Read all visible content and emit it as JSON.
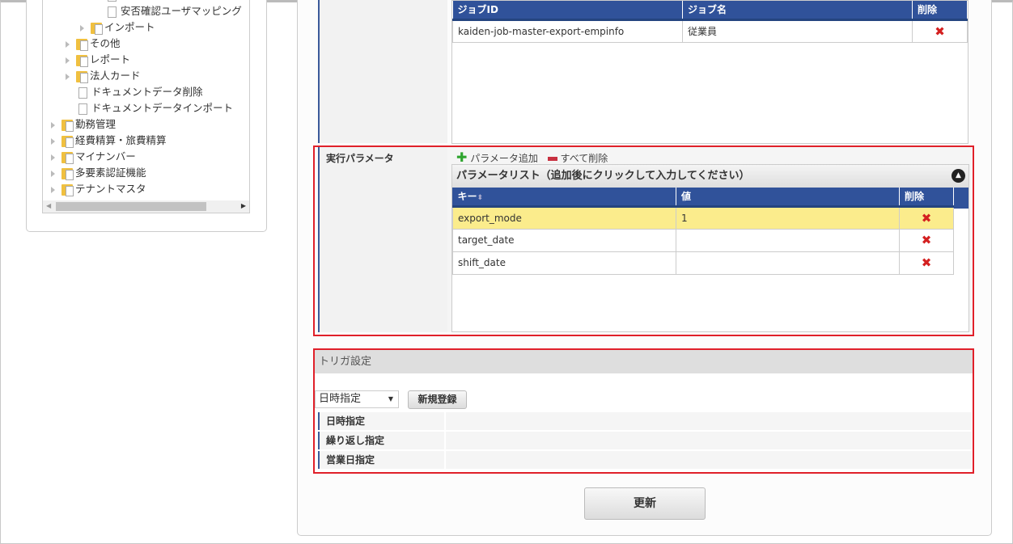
{
  "tree": {
    "items": [
      {
        "label": "安否確認ユーザマッピング",
        "type": "doc"
      },
      {
        "label": "インポート",
        "type": "folder"
      },
      {
        "label": "その他",
        "type": "folder"
      },
      {
        "label": "レポート",
        "type": "folder"
      },
      {
        "label": "法人カード",
        "type": "folder"
      },
      {
        "label": "ドキュメントデータ削除",
        "type": "doc"
      },
      {
        "label": "ドキュメントデータインポート",
        "type": "doc"
      },
      {
        "label": "勤務管理",
        "type": "folder"
      },
      {
        "label": "経費精算・旅費精算",
        "type": "folder"
      },
      {
        "label": "マイナンバー",
        "type": "folder"
      },
      {
        "label": "多要素認証機能",
        "type": "folder"
      },
      {
        "label": "テナントマスタ",
        "type": "folder"
      }
    ]
  },
  "jobs": {
    "headers": [
      "ジョブID",
      "ジョブ名",
      "削除"
    ],
    "rows": [
      {
        "id": "kaiden-job-master-export-empinfo",
        "name": "従業員"
      }
    ]
  },
  "params": {
    "label": "実行パラメータ",
    "add_label": "パラメータ追加",
    "delete_all_label": "すべて削除",
    "list_title": "パラメータリスト（追加後にクリックして入力してください）",
    "headers": [
      "キー",
      "値",
      "削除"
    ],
    "rows": [
      {
        "key": "export_mode",
        "value": "1"
      },
      {
        "key": "target_date",
        "value": ""
      },
      {
        "key": "shift_date",
        "value": ""
      }
    ]
  },
  "trigger": {
    "title": "トリガ設定",
    "select_value": "日時指定",
    "new_button": "新規登録",
    "rows": [
      "日時指定",
      "繰り返し指定",
      "営業日指定"
    ]
  },
  "update_button": "更新",
  "colors": {
    "header": "#30529a",
    "highlight": "#fbec8c",
    "red": "#e0202a"
  }
}
